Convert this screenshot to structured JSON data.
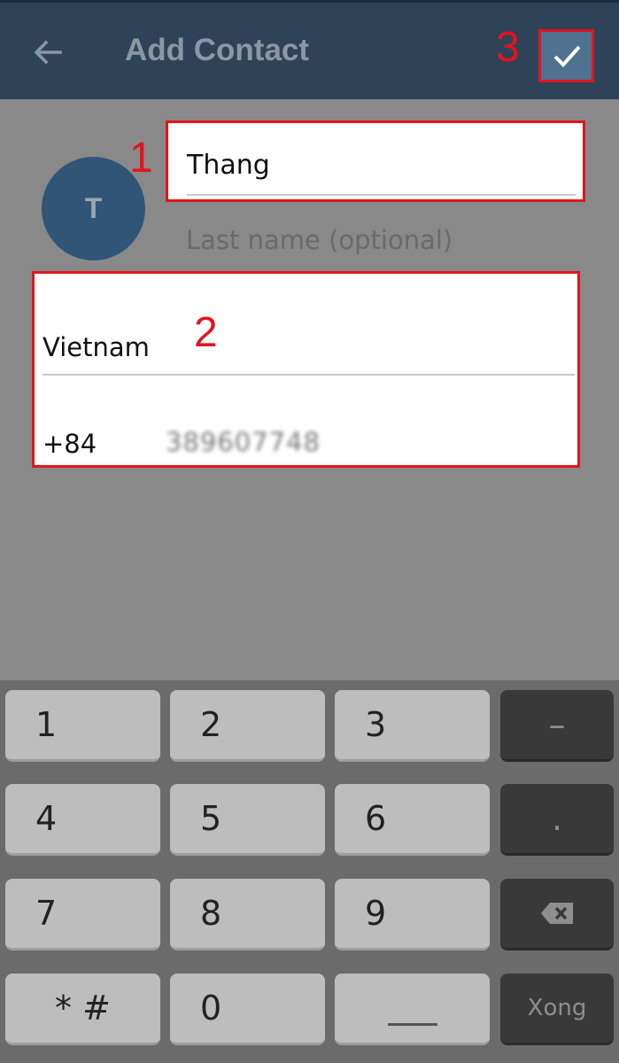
{
  "appbar": {
    "title": "Add Contact",
    "back_icon": "arrow-left-icon",
    "done_icon": "check-icon"
  },
  "annotations": {
    "step1": "1",
    "step2": "2",
    "step3": "3"
  },
  "avatar": {
    "initial": "T"
  },
  "form": {
    "first_name": "Thang",
    "last_name_placeholder": "Last name (optional)",
    "country": "Vietnam",
    "country_code": "+84",
    "phone_number": "389607748"
  },
  "keyboard": {
    "keys": {
      "k1": "1",
      "k2": "2",
      "k3": "3",
      "dash": "–",
      "k4": "4",
      "k5": "5",
      "k6": "6",
      "dot": ".",
      "k7": "7",
      "k8": "8",
      "k9": "9",
      "star_hash": "* #",
      "k0": "0",
      "done": "Xong"
    },
    "backspace_icon": "backspace-icon",
    "space_icon": "space-bar-icon"
  },
  "colors": {
    "appbar": "#2e4358",
    "annotation": "#e3141e",
    "avatar": "#305576",
    "done_button": "#4e7290"
  }
}
